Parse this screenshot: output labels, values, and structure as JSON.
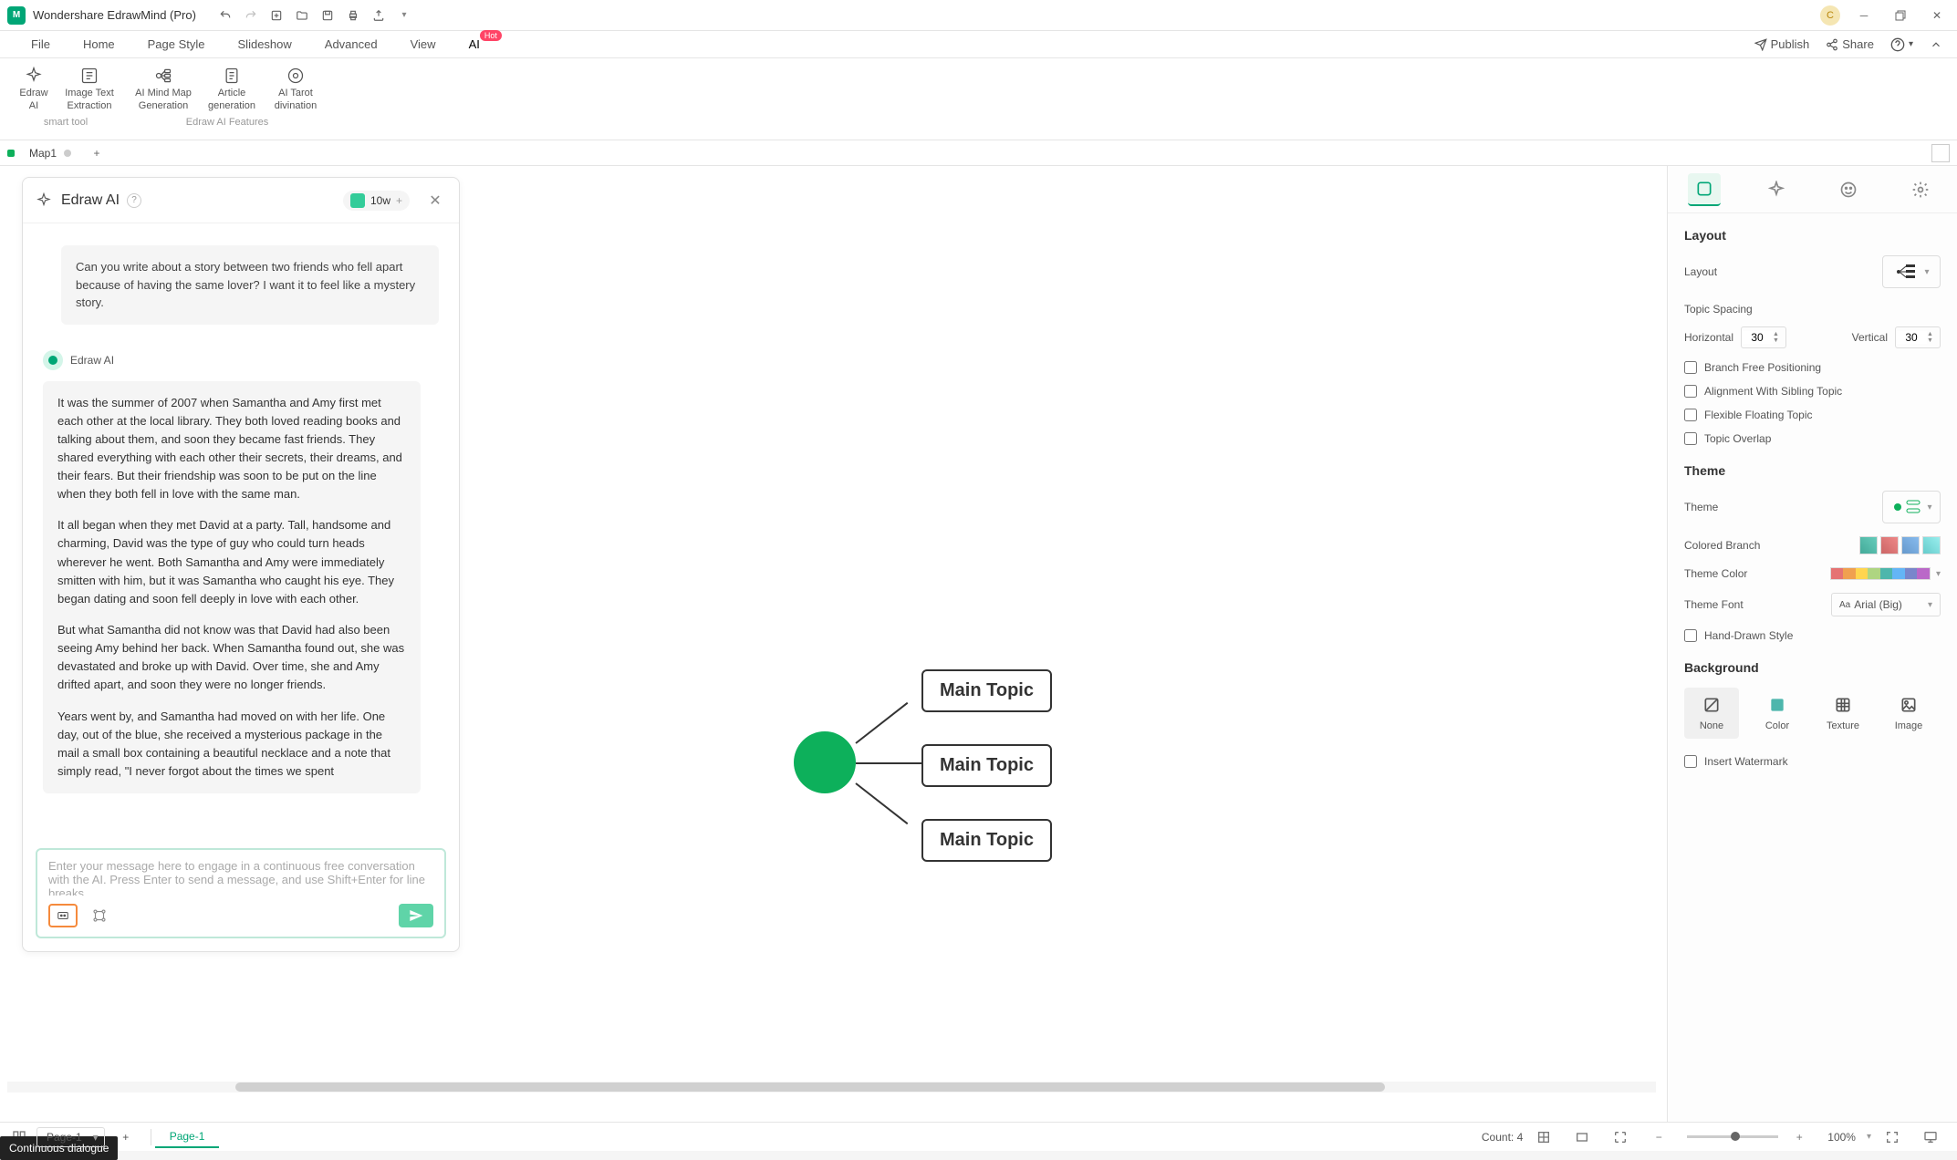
{
  "app": {
    "title": "Wondershare EdrawMind (Pro)",
    "avatar_letter": "C"
  },
  "menu": {
    "items": [
      "File",
      "Home",
      "Page Style",
      "Slideshow",
      "Advanced",
      "View",
      "AI"
    ],
    "hot": "Hot",
    "right": {
      "publish": "Publish",
      "share": "Share"
    }
  },
  "ribbon": {
    "group1_label": "smart tool",
    "group2_label": "Edraw AI Features",
    "btns": [
      {
        "l1": "Edraw",
        "l2": "AI"
      },
      {
        "l1": "Image Text",
        "l2": "Extraction"
      },
      {
        "l1": "AI Mind Map",
        "l2": "Generation"
      },
      {
        "l1": "Article",
        "l2": "generation"
      },
      {
        "l1": "AI Tarot",
        "l2": "divination"
      }
    ]
  },
  "doctabs": {
    "tab1": "Map1"
  },
  "ai_panel": {
    "title": "Edraw AI",
    "credits": "10w",
    "user_msg": "Can you write about a story between two friends who fell apart because of having the same lover? I want it to feel like a mystery story.",
    "ai_name": "Edraw AI",
    "story_p1": "It was the summer of 2007 when Samantha and Amy first met each other at the local library. They both loved reading books and talking about them, and soon they became fast friends. They shared everything with each other  their secrets, their dreams, and their fears. But their friendship was soon to be put on the line when they both fell in love with the same man.",
    "story_p2": "It all began when they met David at a party. Tall, handsome and charming, David was the type of guy who could turn heads wherever he went. Both Samantha and Amy were immediately smitten with him, but it was Samantha who caught his eye. They began dating and soon fell deeply in love with each other.",
    "story_p3": "But what Samantha did not know was that David had also been seeing Amy behind her back. When Samantha found out, she was devastated and broke up with David. Over time, she and Amy drifted apart, and soon they were no longer friends.",
    "story_p4": "Years went by, and Samantha had moved on with her life. One day, out of the blue, she received a mysterious package in the mail  a small box containing a beautiful necklace and a note that simply read, \"I never forgot about the times we spent",
    "placeholder": "Enter your message here to engage in a continuous free conversation with the AI. Press Enter to send a message, and use Shift+Enter for line breaks.",
    "tooltip": "Continuous dialogue"
  },
  "mindmap": {
    "topic1": "Main Topic",
    "topic2": "Main Topic",
    "topic3": "Main Topic"
  },
  "right_panel": {
    "layout_title": "Layout",
    "layout_label": "Layout",
    "topic_spacing": "Topic Spacing",
    "horizontal": "Horizontal",
    "h_val": "30",
    "vertical": "Vertical",
    "v_val": "30",
    "chk1": "Branch Free Positioning",
    "chk2": "Alignment With Sibling Topic",
    "chk3": "Flexible Floating Topic",
    "chk4": "Topic Overlap",
    "theme_title": "Theme",
    "theme_label": "Theme",
    "colored_branch": "Colored Branch",
    "theme_color": "Theme Color",
    "theme_font": "Theme Font",
    "font_value": "Arial (Big)",
    "hand_drawn": "Hand-Drawn Style",
    "bg_title": "Background",
    "bg_none": "None",
    "bg_color": "Color",
    "bg_texture": "Texture",
    "bg_image": "Image",
    "insert_wm": "Insert Watermark"
  },
  "statusbar": {
    "page_select": "Page-1",
    "page_tab": "Page-1",
    "count": "Count: 4",
    "zoom": "100%"
  }
}
